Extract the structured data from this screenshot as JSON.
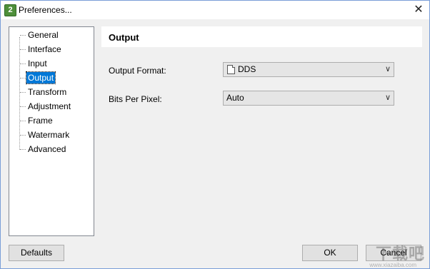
{
  "window": {
    "title": "Preferences...",
    "app_icon_text": "2"
  },
  "tree": {
    "items": [
      {
        "label": "General"
      },
      {
        "label": "Interface"
      },
      {
        "label": "Input"
      },
      {
        "label": "Output",
        "selected": true
      },
      {
        "label": "Transform"
      },
      {
        "label": "Adjustment"
      },
      {
        "label": "Frame"
      },
      {
        "label": "Watermark"
      },
      {
        "label": "Advanced"
      }
    ]
  },
  "panel": {
    "title": "Output",
    "output_format": {
      "label": "Output Format:",
      "value": "DDS",
      "icon": "file-icon"
    },
    "bits_per_pixel": {
      "label": "Bits Per Pixel:",
      "value": "Auto"
    }
  },
  "buttons": {
    "defaults": "Defaults",
    "ok": "OK",
    "cancel": "Cancel"
  },
  "watermark": {
    "text": "下载吧",
    "sub": "www.xiazaiba.com"
  },
  "colors": {
    "selection": "#0078d7",
    "border": "#7a9ed8"
  }
}
